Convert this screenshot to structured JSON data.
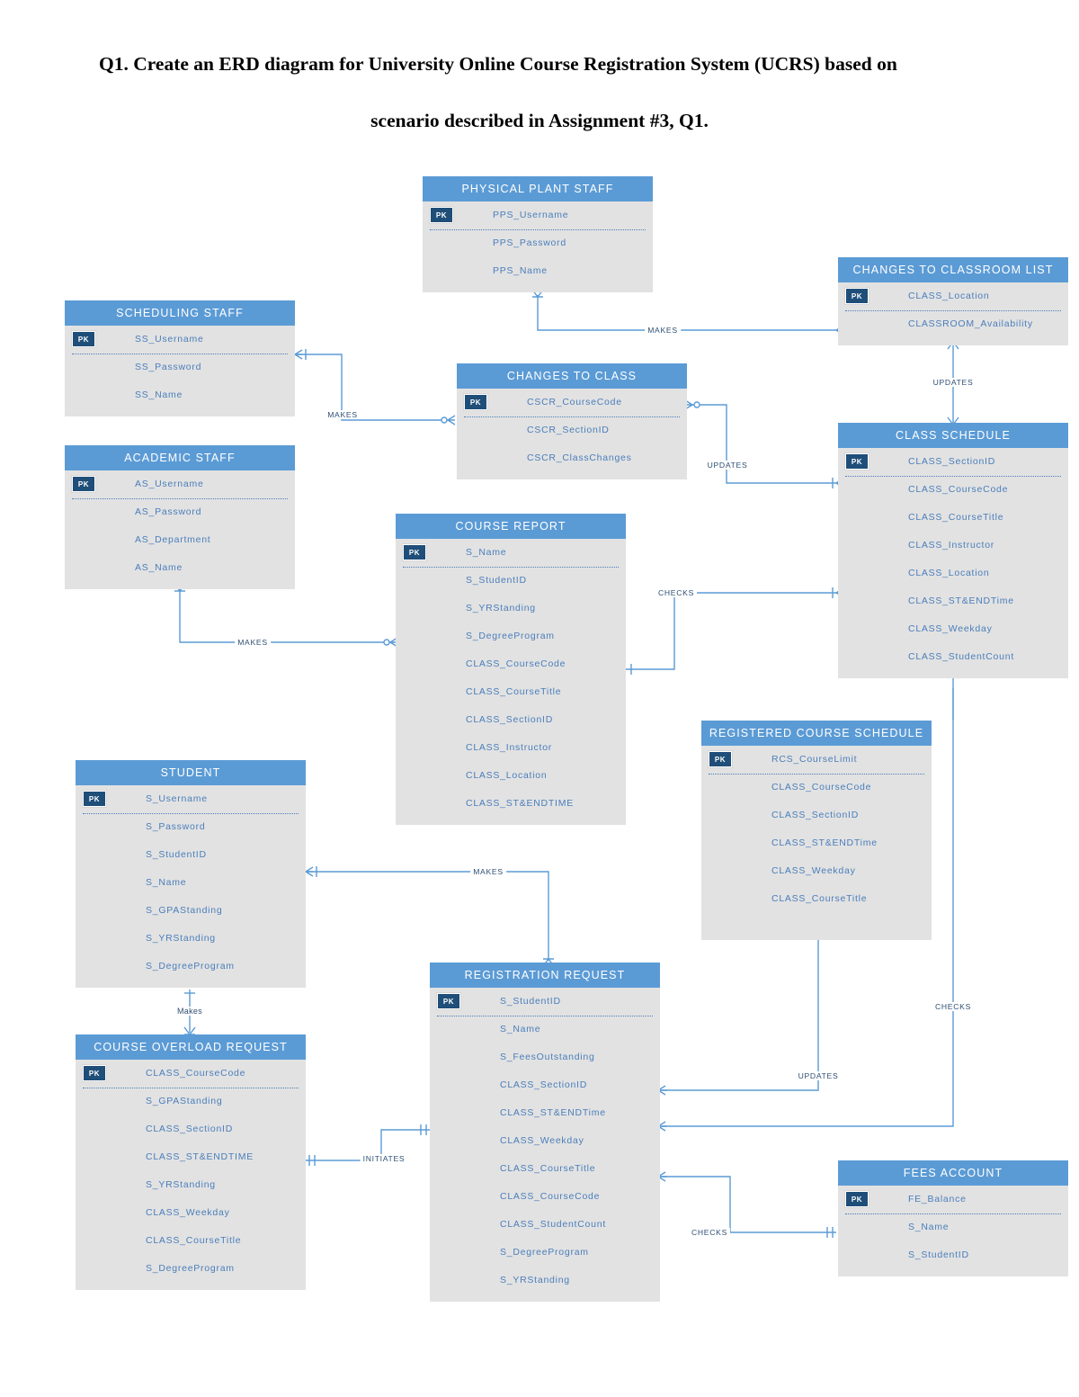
{
  "title": {
    "line1": "Q1. Create an ERD diagram for University Online Course Registration System (UCRS) based on",
    "line2": "scenario described in Assignment #3, Q1."
  },
  "colors": {
    "entity_header": "#5B9BD5",
    "entity_body": "#E2E2E2",
    "attribute_text": "#4A7EBB",
    "pk_badge": "#1F4E79",
    "connector": "#5B9BD5"
  },
  "pk_label": "PK",
  "entities": [
    {
      "name": "PHYSICAL PLANT STAFF",
      "pk": "PPS_Username",
      "attributes": [
        "PPS_Password",
        "PPS_Name"
      ]
    },
    {
      "name": "CHANGES TO CLASSROOM LIST",
      "pk": "CLASS_Location",
      "attributes": [
        "CLASSROOM_Availability"
      ]
    },
    {
      "name": "SCHEDULING STAFF",
      "pk": "SS_Username",
      "attributes": [
        "SS_Password",
        "SS_Name"
      ]
    },
    {
      "name": "CHANGES TO CLASS",
      "pk": "CSCR_CourseCode",
      "attributes": [
        "CSCR_SectionID",
        "CSCR_ClassChanges"
      ]
    },
    {
      "name": "CLASS SCHEDULE",
      "pk": "CLASS_SectionID",
      "attributes": [
        "CLASS_CourseCode",
        "CLASS_CourseTitle",
        "CLASS_Instructor",
        "CLASS_Location",
        "CLASS_ST&ENDTime",
        "CLASS_Weekday",
        "CLASS_StudentCount"
      ]
    },
    {
      "name": "ACADEMIC STAFF",
      "pk": "AS_Username",
      "attributes": [
        "AS_Password",
        "AS_Department",
        "AS_Name"
      ]
    },
    {
      "name": "COURSE REPORT",
      "pk": "S_Name",
      "attributes": [
        "S_StudentID",
        "S_YRStanding",
        "S_DegreeProgram",
        "CLASS_CourseCode",
        "CLASS_CourseTitle",
        "CLASS_SectionID",
        "CLASS_Instructor",
        "CLASS_Location",
        "CLASS_ST&ENDTIME"
      ]
    },
    {
      "name": "REGISTERED COURSE SCHEDULE",
      "pk": "RCS_CourseLimit",
      "attributes": [
        "CLASS_CourseCode",
        "CLASS_SectionID",
        "CLASS_ST&ENDTime",
        "CLASS_Weekday",
        "CLASS_CourseTitle"
      ]
    },
    {
      "name": "STUDENT",
      "pk": "S_Username",
      "attributes": [
        "S_Password",
        "S_StudentID",
        "S_Name",
        "S_GPAStanding",
        "S_YRStanding",
        "S_DegreeProgram"
      ]
    },
    {
      "name": "REGISTRATION REQUEST",
      "pk": "S_StudentID",
      "attributes": [
        "S_Name",
        "S_FeesOutstanding",
        "CLASS_SectionID",
        "CLASS_ST&ENDTime",
        "CLASS_Weekday",
        "CLASS_CourseTitle",
        "CLASS_CourseCode",
        "CLASS_StudentCount",
        "S_DegreeProgram",
        "S_YRStanding"
      ]
    },
    {
      "name": "COURSE OVERLOAD REQUEST",
      "pk": "CLASS_CourseCode",
      "attributes": [
        "S_GPAStanding",
        "CLASS_SectionID",
        "CLASS_ST&ENDTIME",
        "S_YRStanding",
        "CLASS_Weekday",
        "CLASS_CourseTitle",
        "S_DegreeProgram"
      ]
    },
    {
      "name": "FEES ACCOUNT",
      "pk": "FE_Balance",
      "attributes": [
        "S_Name",
        "S_StudentID"
      ]
    }
  ],
  "relationships": [
    {
      "label": "MAKES"
    },
    {
      "label": "MAKES"
    },
    {
      "label": "MAKES"
    },
    {
      "label": "MAKES"
    },
    {
      "label": "Makes"
    },
    {
      "label": "UPDATES"
    },
    {
      "label": "UPDATES"
    },
    {
      "label": "UPDATES"
    },
    {
      "label": "CHECKS"
    },
    {
      "label": "CHECKS"
    },
    {
      "label": "CHECKS"
    },
    {
      "label": "INITIATES"
    }
  ]
}
